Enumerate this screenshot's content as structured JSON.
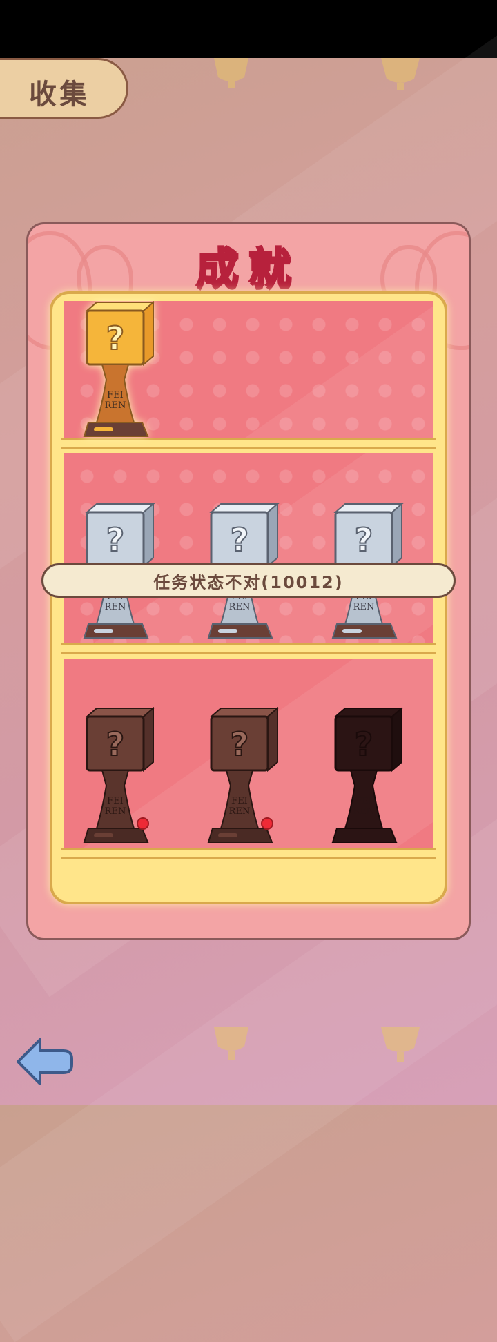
{
  "header": {
    "tab_label": "收集"
  },
  "panel": {
    "title": "成就"
  },
  "trophy_plate_text": "FEI REN",
  "shelves": [
    {
      "trophies": [
        {
          "tier": "gold",
          "unlocked": true,
          "red_dot": false
        }
      ]
    },
    {
      "trophies": [
        {
          "tier": "silver",
          "unlocked": true,
          "red_dot": false
        },
        {
          "tier": "silver",
          "unlocked": true,
          "red_dot": false
        },
        {
          "tier": "silver",
          "unlocked": true,
          "red_dot": false
        }
      ]
    },
    {
      "trophies": [
        {
          "tier": "bronze",
          "unlocked": false,
          "red_dot": true
        },
        {
          "tier": "bronze",
          "unlocked": false,
          "red_dot": true
        },
        {
          "tier": "locked",
          "unlocked": false,
          "red_dot": false
        }
      ]
    }
  ],
  "toast": {
    "message": "任务状态不对(10012)"
  },
  "back_button": {
    "icon": "back-arrow-icon"
  },
  "colors": {
    "gold": "#f5b53a",
    "silver": "#c9d3df",
    "bronze": "#6a3f35",
    "locked": "#2b1414",
    "title_fill": "#ffe14a",
    "title_stroke": "#b7213c"
  }
}
